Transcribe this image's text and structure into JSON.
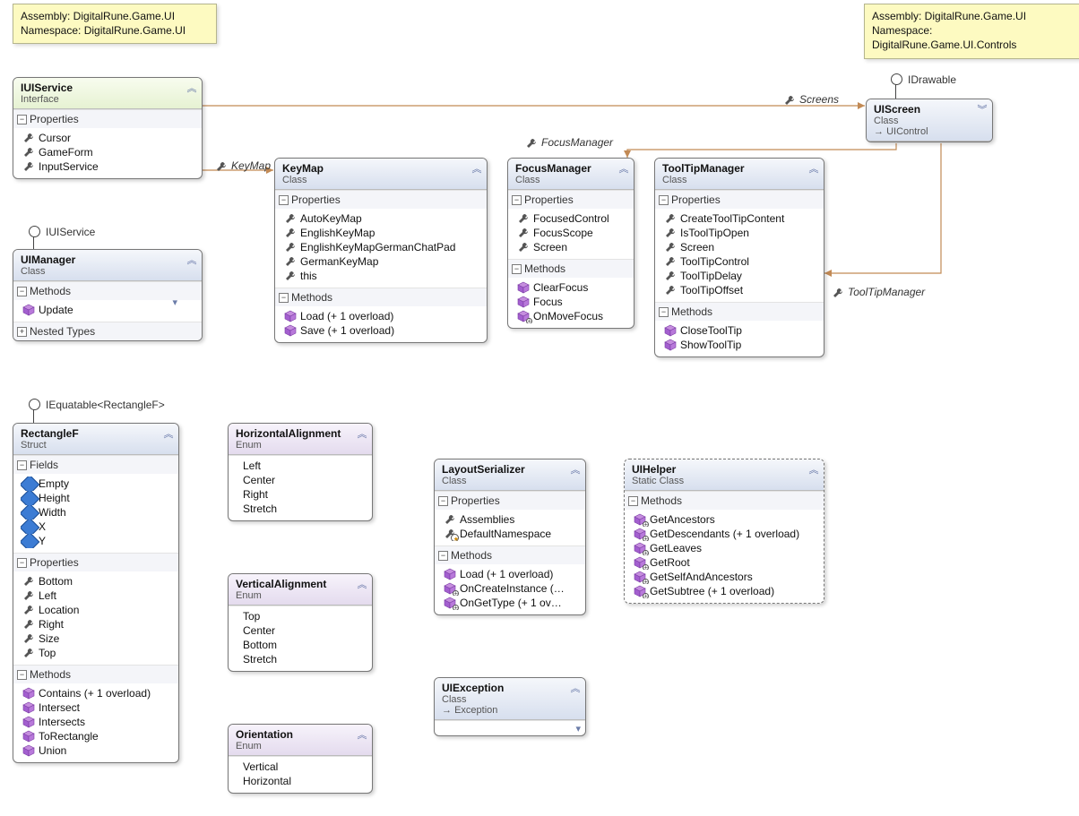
{
  "notes": {
    "left": [
      "Assembly: DigitalRune.Game.UI",
      "Namespace: DigitalRune.Game.UI"
    ],
    "right": [
      "Assembly: DigitalRune.Game.UI",
      "Namespace: DigitalRune.Game.UI.Controls"
    ]
  },
  "connectorLabels": {
    "keyMap": "KeyMap",
    "focusManager": "FocusManager",
    "screens": "Screens",
    "toolTipManager": "ToolTipManager"
  },
  "lollipops": {
    "iuiservice": "IUIService",
    "iequatable": "IEquatable<RectangleF>",
    "idrawable": "IDrawable"
  },
  "boxes": {
    "iuiservice": {
      "name": "IUIService",
      "kind": "Interface",
      "sections": [
        {
          "title": "Properties",
          "icon": "wrench",
          "items": [
            "Cursor",
            "GameForm",
            "InputService"
          ]
        }
      ]
    },
    "uimanager": {
      "name": "UIManager",
      "kind": "Class",
      "filterTop": true,
      "sections": [
        {
          "title": "Methods",
          "icon": "cube",
          "items": [
            "Update"
          ]
        },
        {
          "title": "Nested Types",
          "icon": "",
          "items": [],
          "collapsed": true
        }
      ]
    },
    "keymap": {
      "name": "KeyMap",
      "kind": "Class",
      "filterTop": true,
      "sections": [
        {
          "title": "Properties",
          "icon": "wrench",
          "items": [
            "AutoKeyMap",
            "EnglishKeyMap",
            "EnglishKeyMapGermanChatPad",
            "GermanKeyMap",
            "this"
          ]
        },
        {
          "title": "Methods",
          "icon": "cube",
          "items": [
            "Load (+ 1 overload)",
            "Save (+ 1 overload)"
          ]
        }
      ]
    },
    "focusmanager": {
      "name": "FocusManager",
      "kind": "Class",
      "filterTop": true,
      "sections": [
        {
          "title": "Properties",
          "icon": "wrench",
          "items": [
            "FocusedControl",
            "FocusScope",
            "Screen"
          ]
        },
        {
          "title": "Methods",
          "rows": [
            {
              "t": "ClearFocus",
              "ic": "cube"
            },
            {
              "t": "Focus",
              "ic": "cube"
            },
            {
              "t": "OnMoveFocus",
              "ic": "cubep"
            }
          ]
        }
      ]
    },
    "tooltipmanager": {
      "name": "ToolTipManager",
      "kind": "Class",
      "filterTop": true,
      "sections": [
        {
          "title": "Properties",
          "icon": "wrench",
          "items": [
            "CreateToolTipContent",
            "IsToolTipOpen",
            "Screen",
            "ToolTipControl",
            "ToolTipDelay",
            "ToolTipOffset"
          ]
        },
        {
          "title": "Methods",
          "icon": "cube",
          "items": [
            "CloseToolTip",
            "ShowToolTip"
          ]
        }
      ]
    },
    "uiscreen": {
      "name": "UIScreen",
      "kind": "Class",
      "inherits": "UIControl"
    },
    "rectanglef": {
      "name": "RectangleF",
      "kind": "Struct",
      "filterTop": true,
      "sections": [
        {
          "title": "Fields",
          "icon": "box",
          "items": [
            "Empty",
            "Height",
            "Width",
            "X",
            "Y"
          ]
        },
        {
          "title": "Properties",
          "icon": "wrench",
          "items": [
            "Bottom",
            "Left",
            "Location",
            "Right",
            "Size",
            "Top"
          ]
        },
        {
          "title": "Methods",
          "icon": "cube",
          "items": [
            "Contains (+ 1 overload)",
            "Intersect",
            "Intersects",
            "ToRectangle",
            "Union"
          ]
        }
      ]
    },
    "halign": {
      "name": "HorizontalAlignment",
      "kind": "Enum",
      "sections": [
        {
          "title": "",
          "icon": "",
          "plain": true,
          "items": [
            "Left",
            "Center",
            "Right",
            "Stretch"
          ]
        }
      ]
    },
    "valign": {
      "name": "VerticalAlignment",
      "kind": "Enum",
      "sections": [
        {
          "title": "",
          "icon": "",
          "plain": true,
          "items": [
            "Top",
            "Center",
            "Bottom",
            "Stretch"
          ]
        }
      ]
    },
    "orientation": {
      "name": "Orientation",
      "kind": "Enum",
      "sections": [
        {
          "title": "",
          "icon": "",
          "plain": true,
          "items": [
            "Vertical",
            "Horizontal"
          ]
        }
      ]
    },
    "layout": {
      "name": "LayoutSerializer",
      "kind": "Class",
      "filterTop": true,
      "sections": [
        {
          "title": "Properties",
          "rows": [
            {
              "t": "Assemblies",
              "ic": "wrench"
            },
            {
              "t": "DefaultNamespace",
              "ic": "wrenchp"
            }
          ]
        },
        {
          "title": "Methods",
          "rows": [
            {
              "t": "Load (+ 1 overload)",
              "ic": "cube"
            },
            {
              "t": "OnCreateInstance  (…",
              "ic": "cubep"
            },
            {
              "t": "OnGetType (+ 1 ov…",
              "ic": "cubep"
            }
          ]
        }
      ]
    },
    "uihelper": {
      "name": "UIHelper",
      "kind": "Static Class",
      "filterTop": true,
      "dashed": true,
      "sections": [
        {
          "title": "Methods",
          "rows": [
            {
              "t": "GetAncestors",
              "ic": "cubep"
            },
            {
              "t": "GetDescendants (+ 1 overload)",
              "ic": "cubep"
            },
            {
              "t": "GetLeaves",
              "ic": "cubep"
            },
            {
              "t": "GetRoot",
              "ic": "cubep"
            },
            {
              "t": "GetSelfAndAncestors",
              "ic": "cubep"
            },
            {
              "t": "GetSubtree (+ 1 overload)",
              "ic": "cubep"
            }
          ]
        }
      ]
    },
    "uiexception": {
      "name": "UIException",
      "kind": "Class",
      "inherits": "Exception",
      "filterTop": true
    }
  }
}
